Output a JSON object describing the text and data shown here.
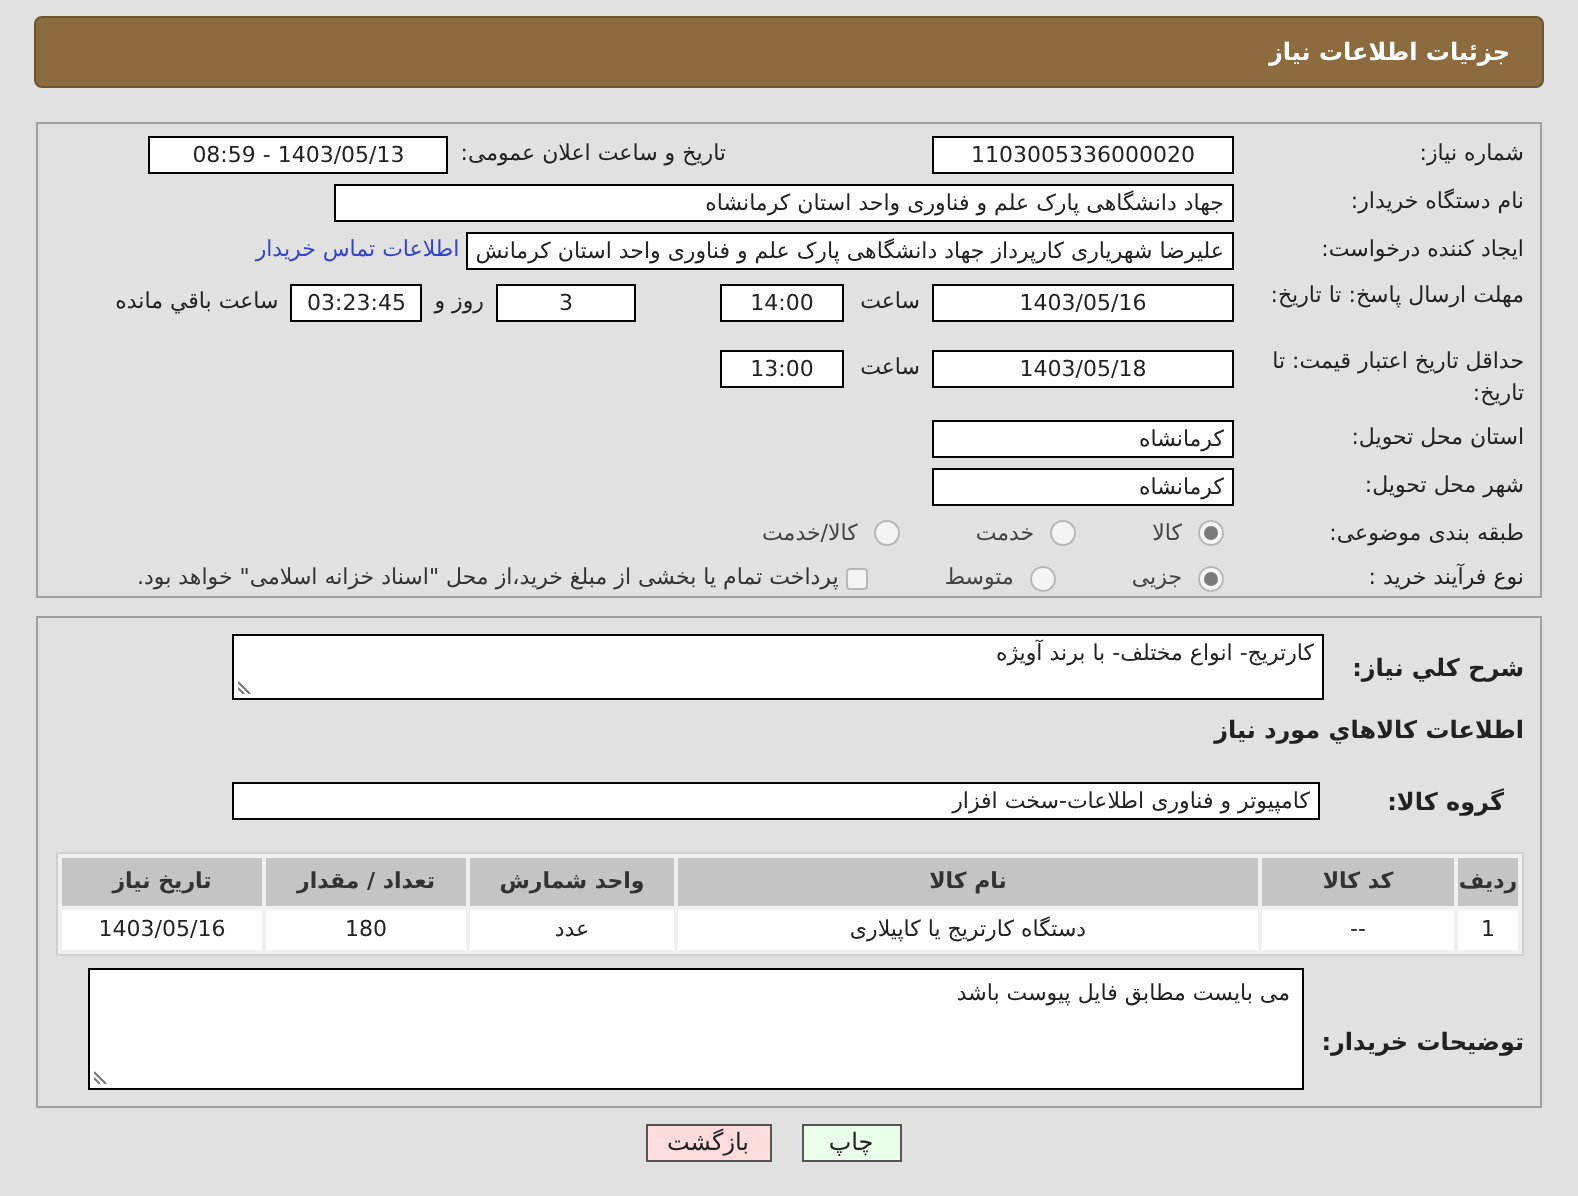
{
  "page_title": "جزئیات اطلاعات نیاز",
  "need_number": {
    "label": "شماره نیاز:",
    "value": "1103005336000020"
  },
  "announce": {
    "label": "تاریخ و ساعت اعلان عمومی:",
    "value": "1403/05/13 - 08:59"
  },
  "buyer": {
    "label": "نام دستگاه خریدار:",
    "value": "جهاد دانشگاهی پارک علم و فناوری واحد استان کرمانشاه"
  },
  "requester": {
    "label": "ایجاد کننده درخواست:",
    "value": "علیرضا شهریاری کارپرداز جهاد دانشگاهی پارک علم و فناوری واحد استان کرمانش",
    "link": "اطلاعات تماس خریدار"
  },
  "deadline": {
    "label": "مهلت ارسال پاسخ: تا تاریخ:",
    "date": "1403/05/16",
    "time_label": "ساعت",
    "time": "14:00",
    "days": "3",
    "days_label": "روز و",
    "remaining": "03:23:45",
    "remaining_label": "ساعت باقي مانده"
  },
  "validity": {
    "label": "حداقل تاریخ اعتبار قیمت: تا تاریخ:",
    "date": "1403/05/18",
    "time_label": "ساعت",
    "time": "13:00"
  },
  "province": {
    "label": "استان محل تحویل:",
    "value": "کرمانشاه"
  },
  "city": {
    "label": "شهر محل تحویل:",
    "value": "کرمانشاه"
  },
  "category": {
    "label": "طبقه بندی موضوعی:",
    "options": [
      {
        "label": "کالا",
        "selected": true
      },
      {
        "label": "خدمت",
        "selected": false
      },
      {
        "label": "کالا/خدمت",
        "selected": false
      }
    ]
  },
  "process": {
    "label": "نوع فرآیند خرید :",
    "options": [
      {
        "label": "جزیی",
        "selected": true
      },
      {
        "label": "متوسط",
        "selected": false
      }
    ],
    "payment": {
      "label": "پرداخت تمام یا بخشی از مبلغ خرید،از محل \"اسناد خزانه اسلامی\" خواهد بود.",
      "checked": false
    }
  },
  "description": {
    "label": "شرح کلي نياز:",
    "value": "کارتریج- انواع مختلف- با برند آویژه"
  },
  "items_heading": "اطلاعات كالاهاي مورد نياز",
  "goods_group": {
    "label": "گروه کالا:",
    "value": "کامپیوتر و فناوری اطلاعات-سخت افزار"
  },
  "table": {
    "columns": [
      "ردیف",
      "کد کالا",
      "نام کالا",
      "واحد شمارش",
      "تعداد / مقدار",
      "تاریخ نیاز"
    ],
    "rows": [
      [
        "1",
        "--",
        "دستگاه کارتریج یا کاپیلاری",
        "عدد",
        "180",
        "1403/05/16"
      ]
    ]
  },
  "buyer_notes": {
    "label": "توضیحات خریدار:",
    "value": "می بایست مطابق فایل پیوست باشد"
  },
  "buttons": [
    {
      "label": "چاپ",
      "kind": "print"
    },
    {
      "label": "بازگشت",
      "kind": "back"
    }
  ]
}
